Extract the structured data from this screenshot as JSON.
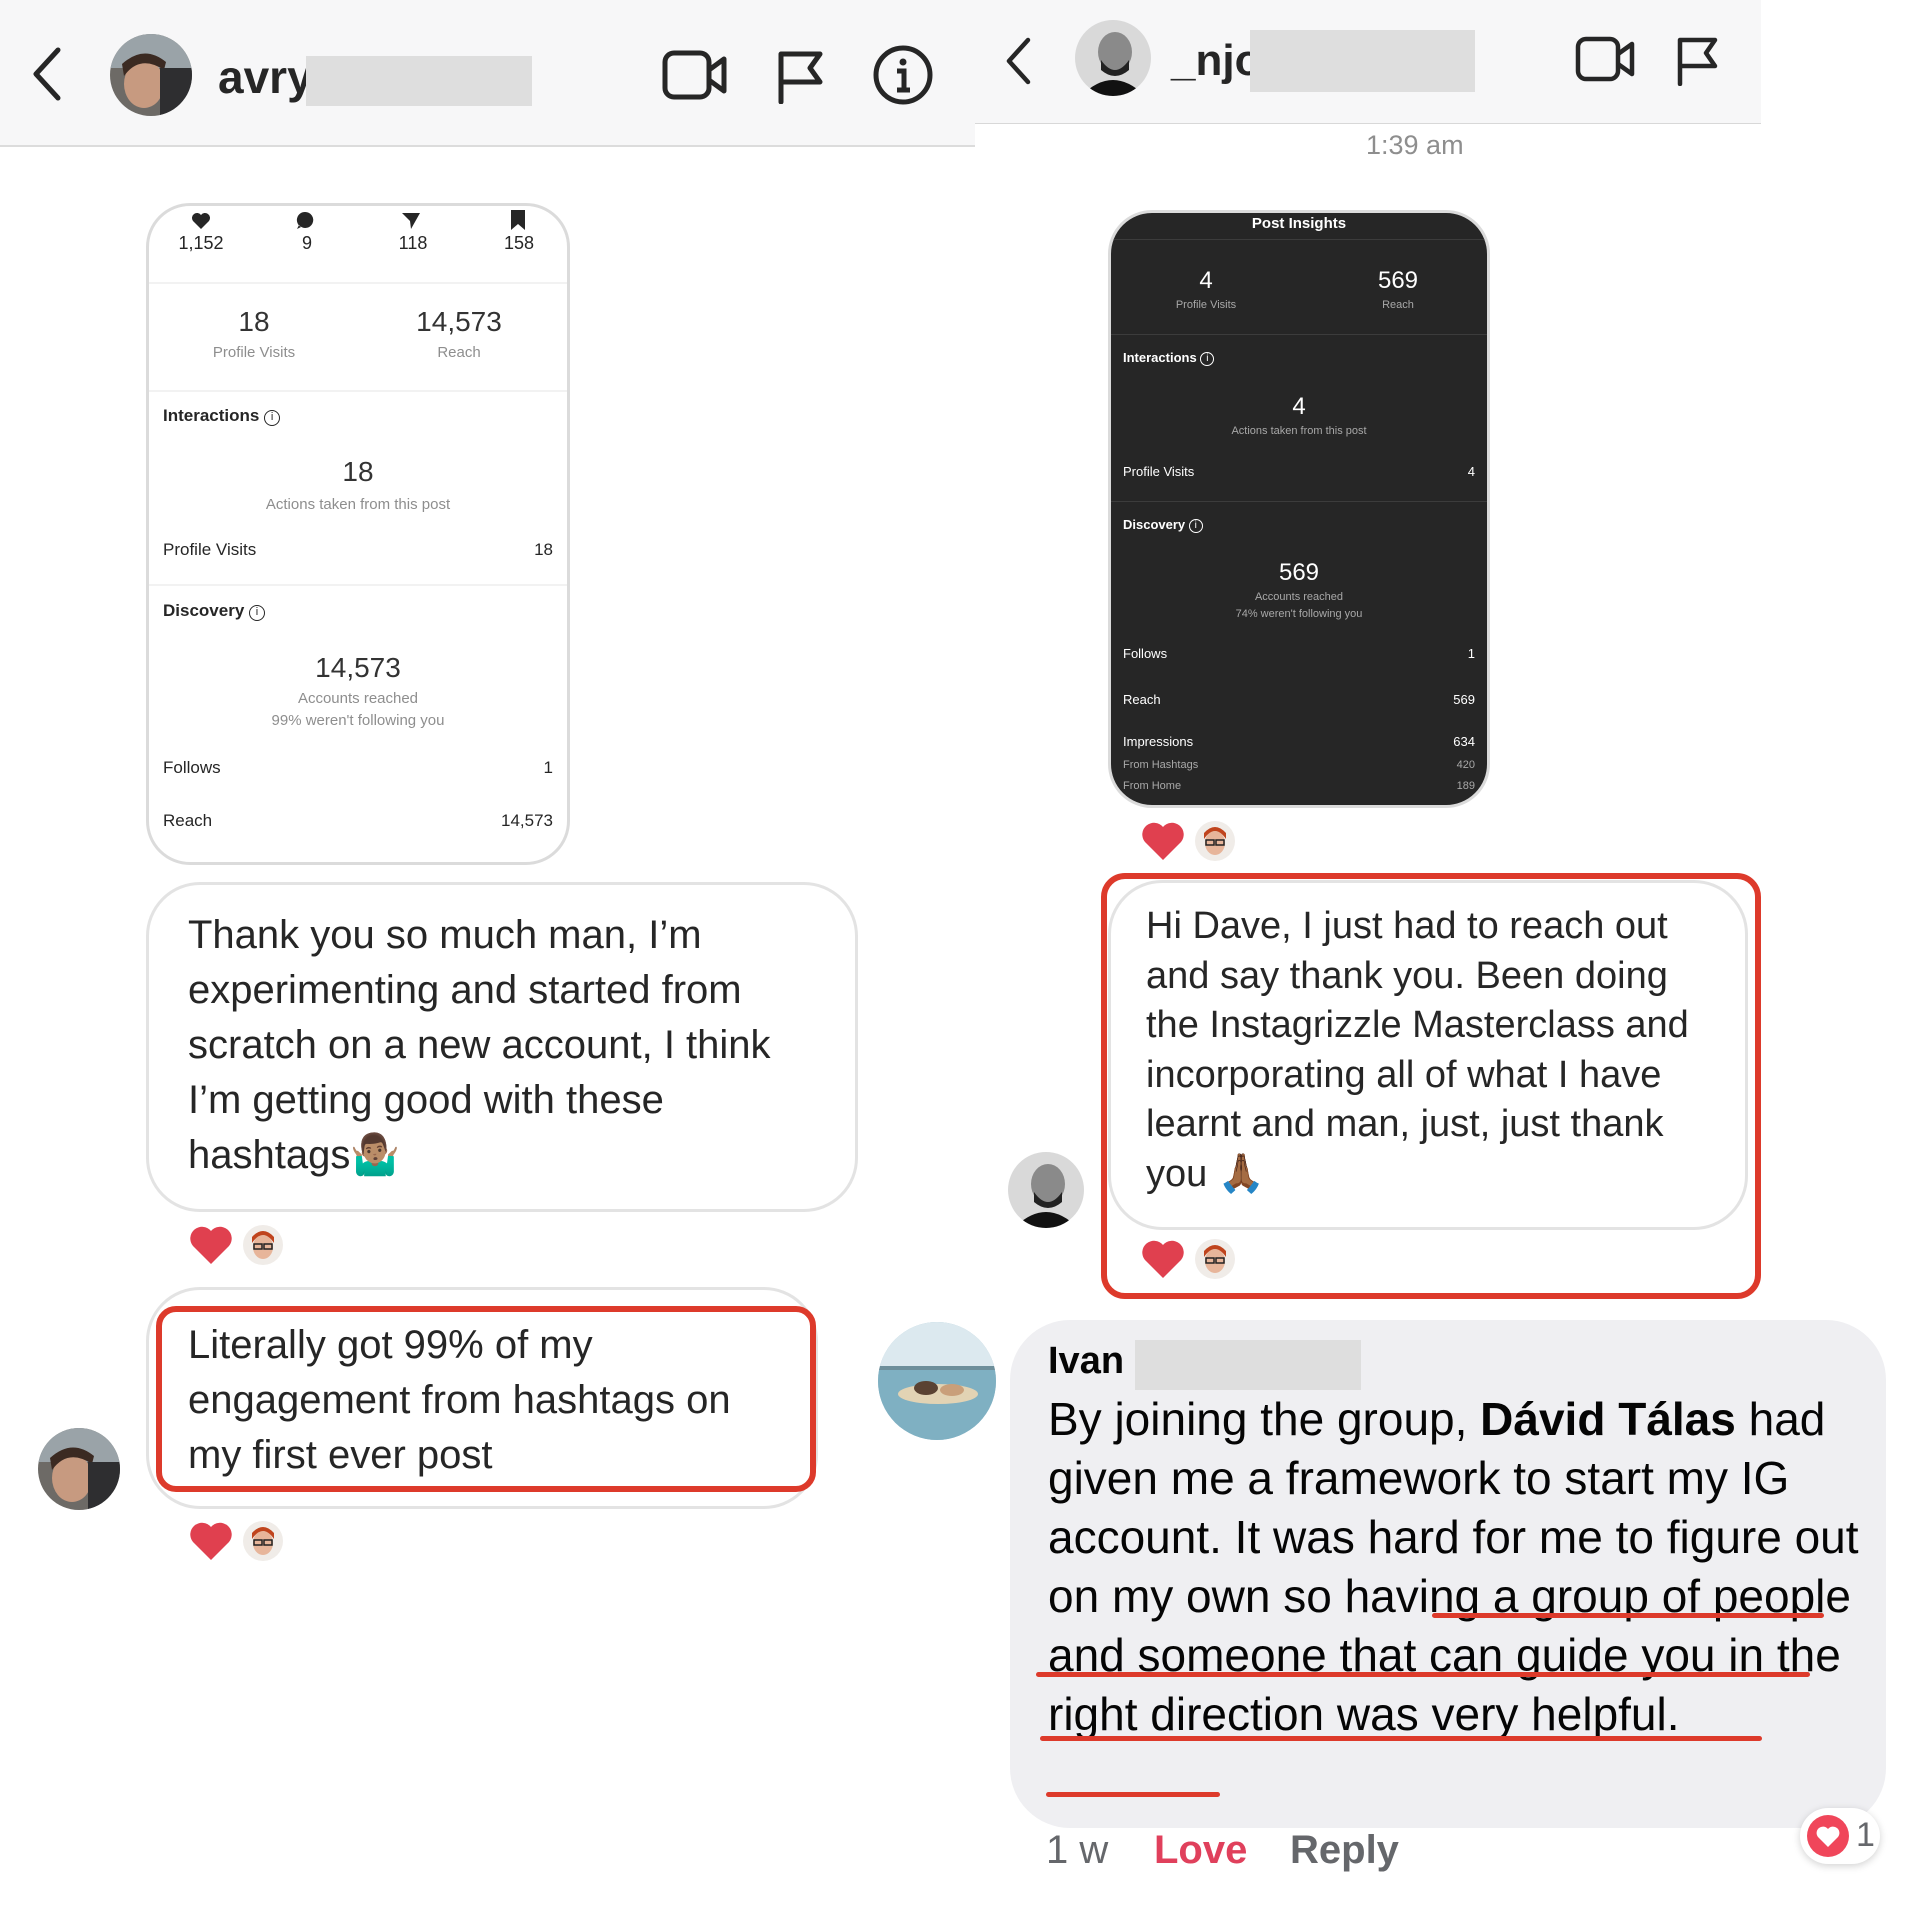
{
  "left_thread": {
    "header": {
      "back_icon": "chevron-left-icon",
      "username": "avry",
      "icons": [
        "video-camera-icon",
        "flag-icon",
        "info-icon"
      ]
    },
    "insights_card": {
      "stats": [
        "1,152",
        "9",
        "118",
        "158"
      ],
      "stat_icons": [
        "heart-icon",
        "comment-icon",
        "share-icon",
        "bookmark-icon"
      ],
      "profile_visits_value": "18",
      "profile_visits_label": "Profile Visits",
      "reach_value": "14,573",
      "reach_label": "Reach",
      "interactions_title": "Interactions",
      "interactions_value": "18",
      "interactions_sub": "Actions taken from this post",
      "row_profile_visits_label": "Profile Visits",
      "row_profile_visits_value": "18",
      "discovery_title": "Discovery",
      "discovery_value": "14,573",
      "discovery_sub1": "Accounts reached",
      "discovery_sub2": "99% weren't following you",
      "follows_label": "Follows",
      "follows_value": "1",
      "reach_row_label": "Reach",
      "reach_row_value": "14,573"
    },
    "message_1": "Thank you so much man, I’m experimenting and started from scratch on a new account, I think I’m getting good with these hashtags🤷🏽‍♂️",
    "message_2": "Literally got 99% of my engagement from hashtags on my first ever post"
  },
  "right_thread": {
    "header": {
      "back_icon": "chevron-left-icon",
      "username": "_njo",
      "icons": [
        "video-camera-icon",
        "flag-icon"
      ]
    },
    "timestamp": "1:39 am",
    "insights_card": {
      "title": "Post Insights",
      "profile_visits_value": "4",
      "profile_visits_label": "Profile Visits",
      "reach_value": "569",
      "reach_label": "Reach",
      "interactions_title": "Interactions",
      "interactions_value": "4",
      "interactions_sub": "Actions taken from this post",
      "row_profile_visits_label": "Profile Visits",
      "row_profile_visits_value": "4",
      "discovery_title": "Discovery",
      "discovery_value": "569",
      "discovery_sub1": "Accounts reached",
      "discovery_sub2": "74% weren't following you",
      "follows_label": "Follows",
      "follows_value": "1",
      "reach_row_label": "Reach",
      "reach_row_value": "569",
      "impressions_label": "Impressions",
      "impressions_value": "634",
      "from_hashtags_label": "From Hashtags",
      "from_hashtags_value": "420",
      "from_home_label": "From Home",
      "from_home_value": "189"
    },
    "message": "Hi Dave, I just had to reach out and say thank you. Been doing the Instagrizzle Masterclass and incorporating all of what I have learnt and man, just, just thank you 🙏🏾"
  },
  "facebook_comment": {
    "author": "Ivan",
    "text_part1": "By joining the group, ",
    "text_bold": "Dávid Tálas",
    "text_part2": " had given me a framework to start my IG account. It was hard for me to figure out on my own so having a group of people and someone that can guide you in the right direction was very helpful.",
    "time": "1 w",
    "love_label": "Love",
    "reply_label": "Reply",
    "reaction_count": "1",
    "colors": {
      "love": "#e0405c",
      "underline": "#dd3a2b",
      "bubble": "#efeff2"
    }
  },
  "colors": {
    "highlight_box": "#dd3a2b",
    "heart": "#e0404f"
  }
}
